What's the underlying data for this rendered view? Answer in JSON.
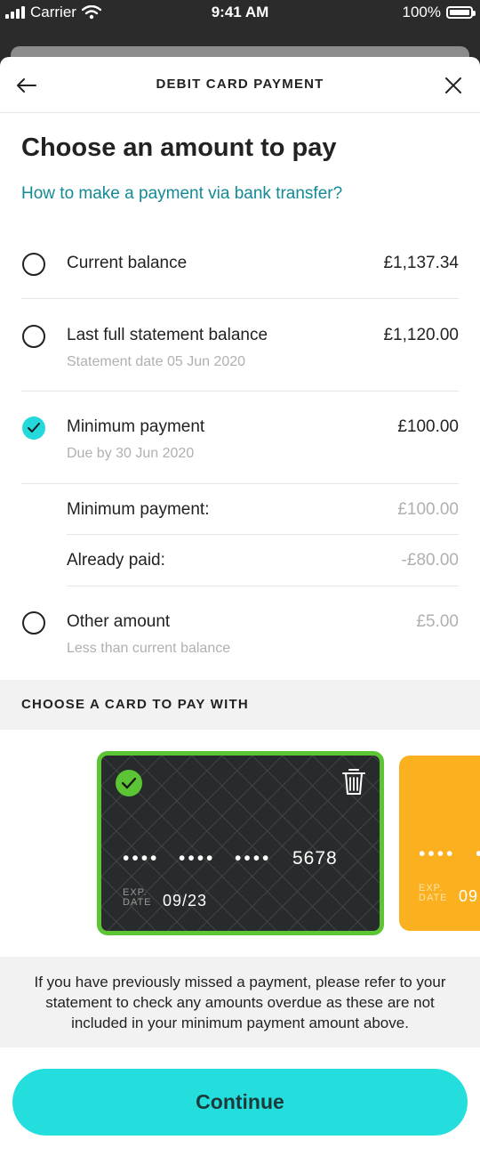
{
  "status_bar": {
    "carrier": "Carrier",
    "time": "9:41 AM",
    "battery": "100%"
  },
  "header": {
    "title": "DEBIT CARD PAYMENT",
    "back_icon": "arrow-left-icon",
    "close_icon": "close-icon"
  },
  "heading": "Choose an amount to pay",
  "bank_transfer_link": "How to make a payment via bank transfer?",
  "options": [
    {
      "label": "Current balance",
      "amount": "£1,137.34",
      "selected": false
    },
    {
      "label": "Last full statement balance",
      "sublabel": "Statement date 05 Jun 2020",
      "amount": "£1,120.00",
      "selected": false
    },
    {
      "label": "Minimum payment",
      "sublabel": "Due by 30 Jun 2020",
      "amount": "£100.00",
      "selected": true
    },
    {
      "label": "Other amount",
      "sublabel": "Less than current balance",
      "amount": "£5.00",
      "selected": false
    }
  ],
  "breakdown": [
    {
      "label": "Minimum payment:",
      "value": "£100.00"
    },
    {
      "label": "Already paid:",
      "value": "-£80.00"
    }
  ],
  "card_section_title": "CHOOSE A CARD TO PAY WITH",
  "cards": [
    {
      "masked_groups": [
        "••••",
        "••••",
        "••••"
      ],
      "last4": "5678",
      "exp_label_1": "EXP.",
      "exp_label_2": "DATE",
      "expiry": "09/23",
      "selected": true,
      "color": "#272b2b"
    },
    {
      "masked_groups": [
        "••••",
        "•"
      ],
      "exp_label_1": "EXP.",
      "exp_label_2": "DATE",
      "expiry": "09",
      "selected": false,
      "color": "#fbb01f"
    }
  ],
  "notice": "If you have previously missed a payment, please refer to your statement to check any amounts overdue as these are not included in your minimum payment amount above.",
  "continue_label": "Continue",
  "colors": {
    "accent": "#24dede",
    "link": "#138a96",
    "selected_card_border": "#5cc534"
  }
}
